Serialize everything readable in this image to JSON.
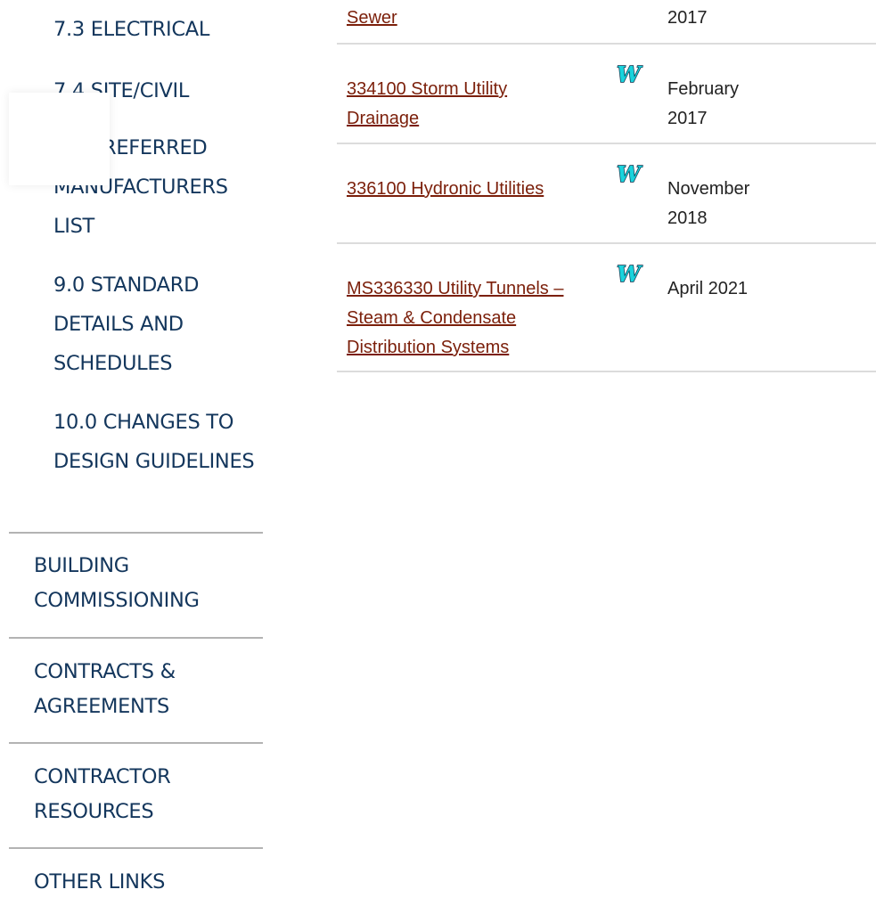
{
  "sidebar": {
    "sub_items": [
      {
        "label": "7.3 ELECTRICAL"
      },
      {
        "label": "7.4 SITE/CIVIL"
      },
      {
        "label": "8.0 PREFERRED MANUFACTURERS LIST"
      },
      {
        "label": "9.0 STANDARD DETAILS AND SCHEDULES"
      },
      {
        "label": "10.0 CHANGES TO DESIGN GUIDELINES"
      }
    ],
    "main_items": [
      {
        "label": "BUILDING COMMISSIONING"
      },
      {
        "label": "CONTRACTS & AGREEMENTS"
      },
      {
        "label": "CONTRACTOR RESOURCES"
      },
      {
        "label": "OTHER LINKS"
      }
    ]
  },
  "documents": {
    "rows": [
      {
        "title": "Sewer",
        "has_word_icon": false,
        "date": "2017"
      },
      {
        "title": "334100 Storm Utility Drainage",
        "has_word_icon": true,
        "date": "February 2017"
      },
      {
        "title": "336100 Hydronic Utilities",
        "has_word_icon": true,
        "date": "November 2018"
      },
      {
        "title": "MS336330 Utility Tunnels – Steam & Condensate Distribution Systems",
        "has_word_icon": true,
        "date": "April 2021"
      }
    ]
  },
  "icons": {
    "word": "word-document-icon"
  },
  "colors": {
    "nav_text": "#13365c",
    "link": "#7b1f0a",
    "word_icon_fill": "#19d3dc",
    "word_icon_outline": "#0b2a44"
  }
}
